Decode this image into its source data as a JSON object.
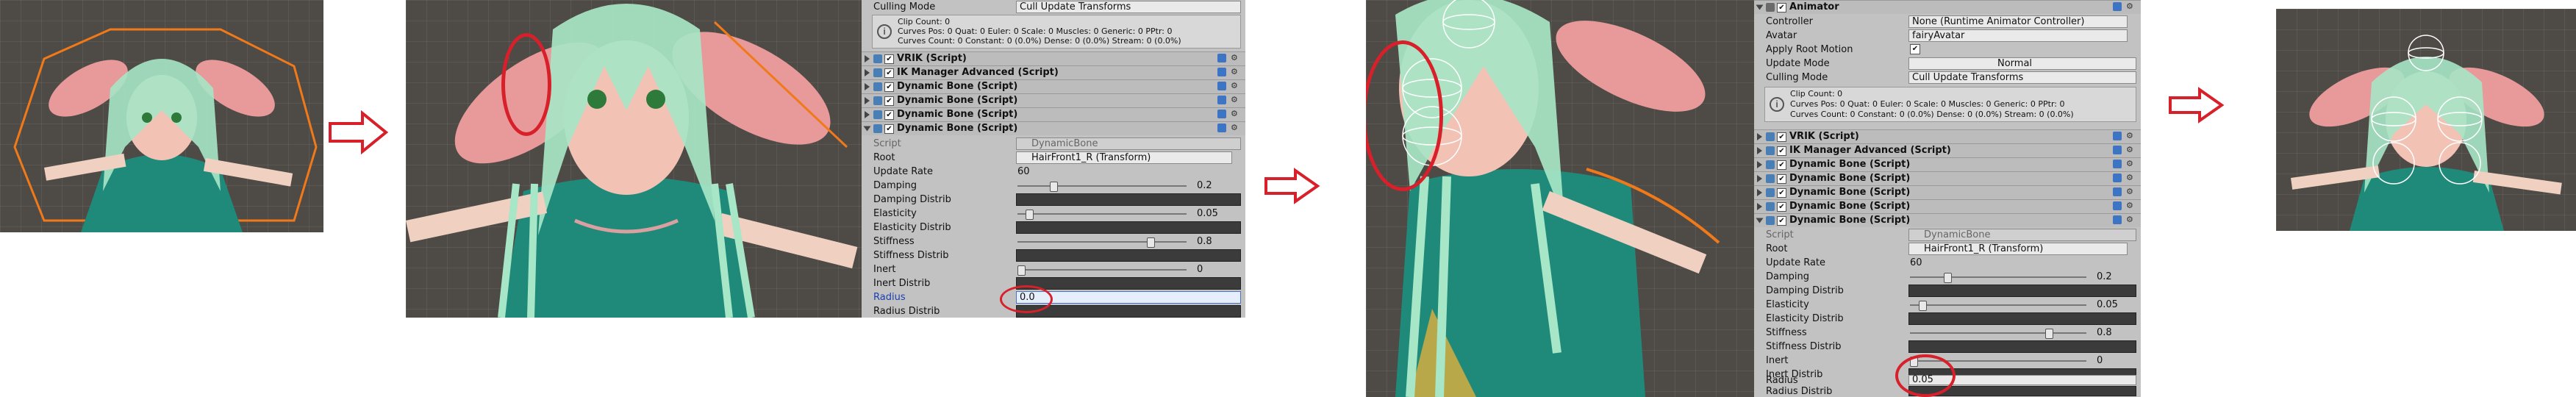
{
  "panel_mid": {
    "header_label": "Culling Mode",
    "header_value": "Cull Update Transforms",
    "info_lines": [
      "Clip Count: 0",
      "Curves Pos: 0 Quat: 0 Euler: 0 Scale: 0 Muscles: 0 Generic: 0 PPtr: 0",
      "Curves Count: 0 Constant: 0 (0.0%) Dense: 0 (0.0%) Stream: 0 (0.0%)"
    ],
    "components": [
      "VRIK (Script)",
      "IK Manager Advanced (Script)",
      "Dynamic Bone (Script)",
      "Dynamic Bone (Script)",
      "Dynamic Bone (Script)",
      "Dynamic Bone (Script)"
    ],
    "fields": {
      "script_label": "Script",
      "script_value": "DynamicBone",
      "root_label": "Root",
      "root_value": "HairFront1_R (Transform)",
      "update_rate_label": "Update Rate",
      "update_rate_value": "60",
      "damping_label": "Damping",
      "damping_value": "0.2",
      "damping_distrib_label": "Damping Distrib",
      "elasticity_label": "Elasticity",
      "elasticity_value": "0.05",
      "elasticity_distrib_label": "Elasticity Distrib",
      "stiffness_label": "Stiffness",
      "stiffness_value": "0.8",
      "stiffness_distrib_label": "Stiffness Distrib",
      "inert_label": "Inert",
      "inert_value": "0",
      "inert_distrib_label": "Inert Distrib",
      "radius_label": "Radius",
      "radius_value": "0.0",
      "radius_distrib_label": "Radius Distrib"
    }
  },
  "panel_right": {
    "animator_title": "Animator",
    "controller_label": "Controller",
    "controller_value": "None (Runtime Animator Controller)",
    "avatar_label": "Avatar",
    "avatar_value": "fairyAvatar",
    "apply_root_label": "Apply Root Motion",
    "update_mode_label": "Update Mode",
    "update_mode_value": "Normal",
    "culling_label": "Culling Mode",
    "culling_value": "Cull Update Transforms",
    "info_lines": [
      "Clip Count: 0",
      "Curves Pos: 0 Quat: 0 Euler: 0 Scale: 0 Muscles: 0 Generic: 0 PPtr: 0",
      "Curves Count: 0 Constant: 0 (0.0%) Dense: 0 (0.0%) Stream: 0 (0.0%)"
    ],
    "components": [
      "VRIK (Script)",
      "IK Manager Advanced (Script)",
      "Dynamic Bone (Script)",
      "Dynamic Bone (Script)",
      "Dynamic Bone (Script)",
      "Dynamic Bone (Script)",
      "Dynamic Bone (Script)"
    ],
    "fields": {
      "script_label": "Script",
      "script_value": "DynamicBone",
      "root_label": "Root",
      "root_value": "HairFront1_R (Transform)",
      "update_rate_label": "Update Rate",
      "update_rate_value": "60",
      "damping_label": "Damping",
      "damping_value": "0.2",
      "damping_distrib_label": "Damping Distrib",
      "elasticity_label": "Elasticity",
      "elasticity_value": "0.05",
      "elasticity_distrib_label": "Elasticity Distrib",
      "stiffness_label": "Stiffness",
      "stiffness_value": "0.8",
      "stiffness_distrib_label": "Stiffness Distrib",
      "inert_label": "Inert",
      "inert_value": "0",
      "inert_distrib_label": "Inert Distrib",
      "radius_label": "Radius",
      "radius_value": "0.05",
      "radius_distrib_label": "Radius Distrib"
    }
  },
  "sliders": {
    "damping": 0.2,
    "elasticity": 0.05,
    "stiffness": 0.8,
    "inert": 0.0
  },
  "colors": {
    "annotation_red": "#d8202a",
    "scene_grid": "#4e4a46",
    "inspector_bg": "#c2c2c2",
    "outline_orange": "#f07a1a"
  },
  "icons": [
    "arrow-right-icon",
    "checkbox-icon",
    "gear-icon",
    "script-icon"
  ]
}
